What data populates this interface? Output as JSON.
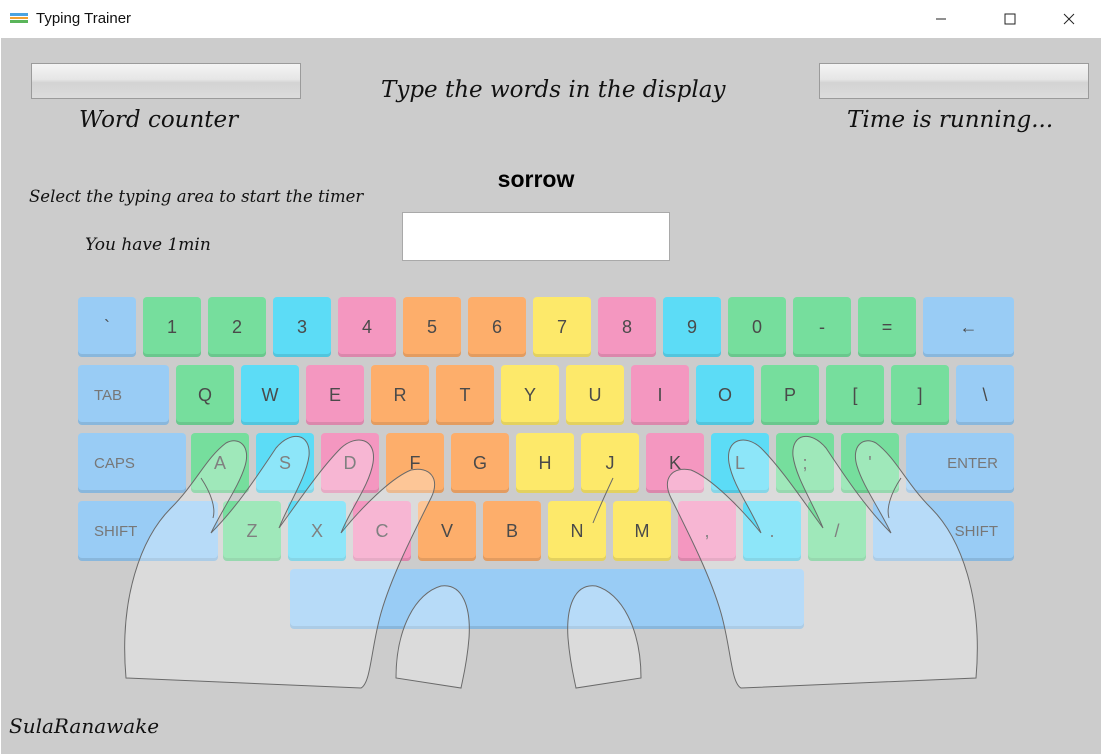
{
  "window": {
    "title": "Typing Trainer",
    "minimize_icon": "minimize-icon",
    "maximize_icon": "maximize-icon",
    "close_icon": "close-icon"
  },
  "header": {
    "instruction": "Type the words in the display",
    "word_counter_label": "Word counter",
    "timer_label": "Time is running...",
    "select_hint": "Select the typing area to start the timer",
    "time_limit": "You have 1min"
  },
  "display": {
    "current_word": "sorrow",
    "input_value": "",
    "input_placeholder": ""
  },
  "keyboard": {
    "colors": {
      "blue": "#99ccf5",
      "green": "#76de9d",
      "cyan": "#5cdcf6",
      "pink": "#f497c0",
      "orange": "#fdae6b",
      "yellow": "#fde96a"
    },
    "rows": [
      [
        {
          "label": "`",
          "color": "blue"
        },
        {
          "label": "1",
          "color": "green"
        },
        {
          "label": "2",
          "color": "green"
        },
        {
          "label": "3",
          "color": "cyan"
        },
        {
          "label": "4",
          "color": "pink"
        },
        {
          "label": "5",
          "color": "orange"
        },
        {
          "label": "6",
          "color": "orange"
        },
        {
          "label": "7",
          "color": "yellow"
        },
        {
          "label": "8",
          "color": "pink"
        },
        {
          "label": "9",
          "color": "cyan"
        },
        {
          "label": "0",
          "color": "green"
        },
        {
          "label": "-",
          "color": "green"
        },
        {
          "label": "=",
          "color": "green"
        },
        {
          "label": "←",
          "color": "blue"
        }
      ],
      [
        {
          "label": "TAB",
          "color": "blue"
        },
        {
          "label": "Q",
          "color": "green"
        },
        {
          "label": "W",
          "color": "cyan"
        },
        {
          "label": "E",
          "color": "pink"
        },
        {
          "label": "R",
          "color": "orange"
        },
        {
          "label": "T",
          "color": "orange"
        },
        {
          "label": "Y",
          "color": "yellow"
        },
        {
          "label": "U",
          "color": "yellow"
        },
        {
          "label": "I",
          "color": "pink"
        },
        {
          "label": "O",
          "color": "cyan"
        },
        {
          "label": "P",
          "color": "green"
        },
        {
          "label": "[",
          "color": "green"
        },
        {
          "label": "]",
          "color": "green"
        },
        {
          "label": "\\",
          "color": "blue"
        }
      ],
      [
        {
          "label": "CAPS",
          "color": "blue"
        },
        {
          "label": "A",
          "color": "green"
        },
        {
          "label": "S",
          "color": "cyan"
        },
        {
          "label": "D",
          "color": "pink"
        },
        {
          "label": "F",
          "color": "orange"
        },
        {
          "label": "G",
          "color": "orange"
        },
        {
          "label": "H",
          "color": "yellow"
        },
        {
          "label": "J",
          "color": "yellow"
        },
        {
          "label": "K",
          "color": "pink"
        },
        {
          "label": "L",
          "color": "cyan"
        },
        {
          "label": ";",
          "color": "green"
        },
        {
          "label": "'",
          "color": "green"
        },
        {
          "label": "ENTER",
          "color": "blue"
        }
      ],
      [
        {
          "label": "SHIFT",
          "color": "blue"
        },
        {
          "label": "Z",
          "color": "green"
        },
        {
          "label": "X",
          "color": "cyan"
        },
        {
          "label": "C",
          "color": "pink"
        },
        {
          "label": "V",
          "color": "orange"
        },
        {
          "label": "B",
          "color": "orange"
        },
        {
          "label": "N",
          "color": "yellow"
        },
        {
          "label": "M",
          "color": "yellow"
        },
        {
          "label": ",",
          "color": "pink"
        },
        {
          "label": ".",
          "color": "cyan"
        },
        {
          "label": "/",
          "color": "green"
        },
        {
          "label": "SHIFT",
          "color": "blue"
        }
      ],
      [
        {
          "label": "",
          "color": "blue"
        }
      ]
    ]
  },
  "footer": {
    "signature": "SulaRanawake"
  }
}
